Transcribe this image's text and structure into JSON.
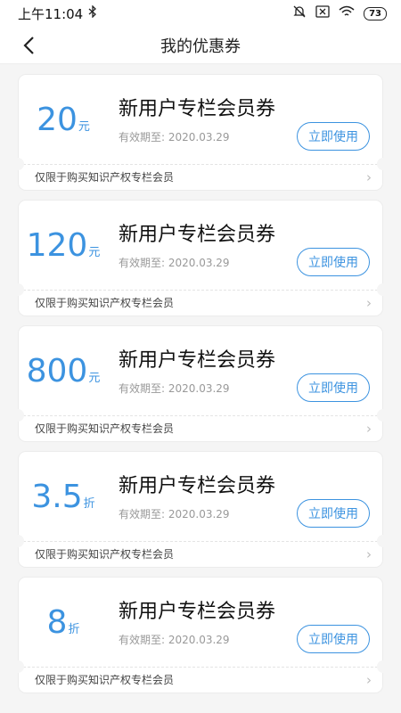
{
  "status_bar": {
    "time": "上午11:04",
    "battery": "73"
  },
  "header": {
    "title": "我的优惠券"
  },
  "coupons": [
    {
      "value": "20",
      "unit": "元",
      "title": "新用户专栏会员券",
      "expiry": "有效期至: 2020.03.29",
      "button": "立即使用",
      "restriction": "仅限于购买知识产权专栏会员"
    },
    {
      "value": "120",
      "unit": "元",
      "title": "新用户专栏会员券",
      "expiry": "有效期至: 2020.03.29",
      "button": "立即使用",
      "restriction": "仅限于购买知识产权专栏会员"
    },
    {
      "value": "800",
      "unit": "元",
      "title": "新用户专栏会员券",
      "expiry": "有效期至: 2020.03.29",
      "button": "立即使用",
      "restriction": "仅限于购买知识产权专栏会员"
    },
    {
      "value": "3.5",
      "unit": "折",
      "title": "新用户专栏会员券",
      "expiry": "有效期至: 2020.03.29",
      "button": "立即使用",
      "restriction": "仅限于购买知识产权专栏会员"
    },
    {
      "value": "8",
      "unit": "折",
      "title": "新用户专栏会员券",
      "expiry": "有效期至: 2020.03.29",
      "button": "立即使用",
      "restriction": "仅限于购买知识产权专栏会员"
    }
  ],
  "colors": {
    "accent": "#3c93e0",
    "background": "#f5f5f5"
  }
}
